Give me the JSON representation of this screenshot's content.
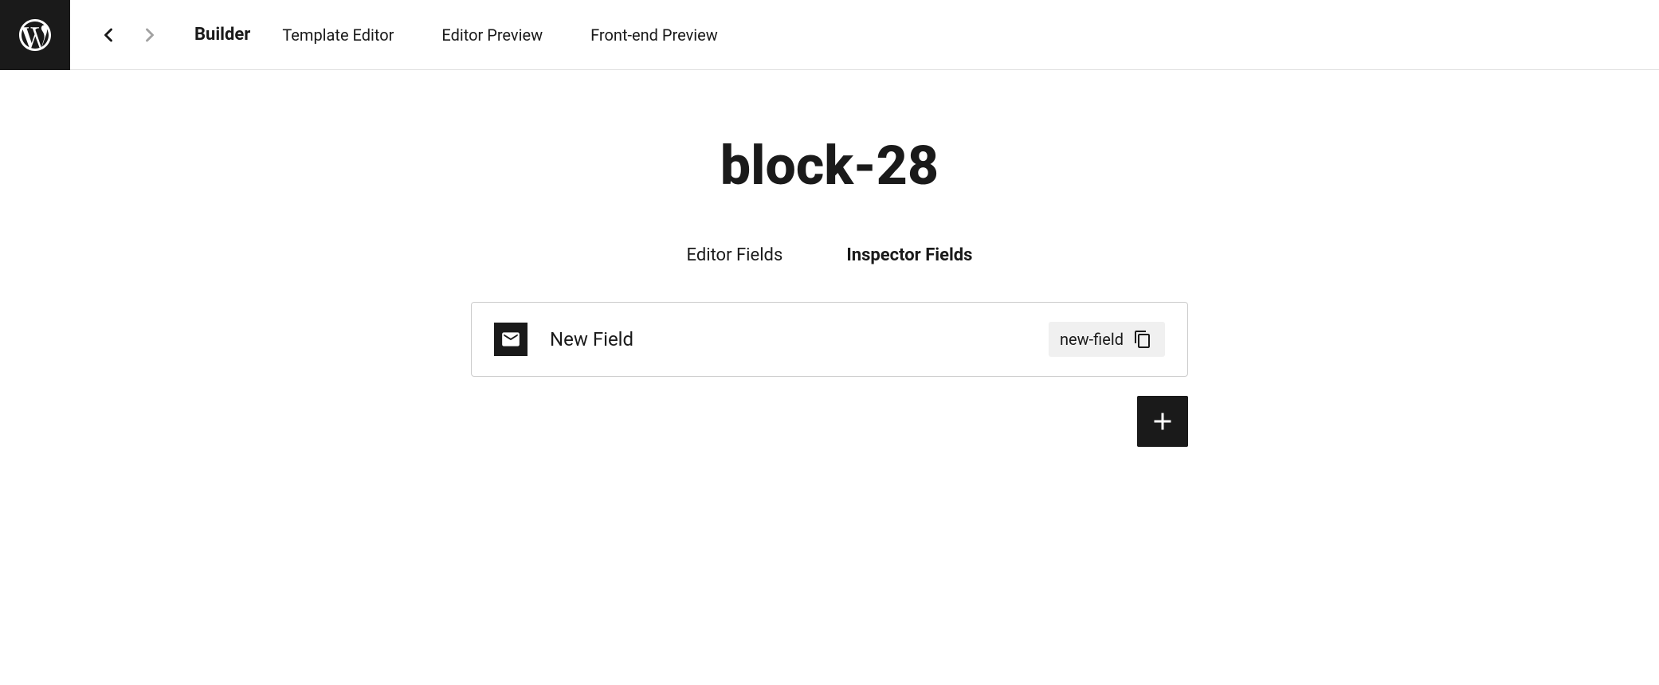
{
  "topbar": {
    "builder_label": "Builder",
    "template_editor_label": "Template Editor",
    "editor_preview_label": "Editor Preview",
    "frontend_preview_label": "Front-end Preview"
  },
  "main": {
    "title": "block-28",
    "tabs": [
      {
        "label": "Editor Fields",
        "active": false
      },
      {
        "label": "Inspector Fields",
        "active": true
      }
    ],
    "field": {
      "name": "New Field",
      "slug": "new-field"
    }
  },
  "buttons": {
    "add_label": "+"
  },
  "icons": {
    "back": "back-arrow-icon",
    "forward": "forward-arrow-icon",
    "envelope": "envelope-icon",
    "copy": "copy-icon"
  }
}
